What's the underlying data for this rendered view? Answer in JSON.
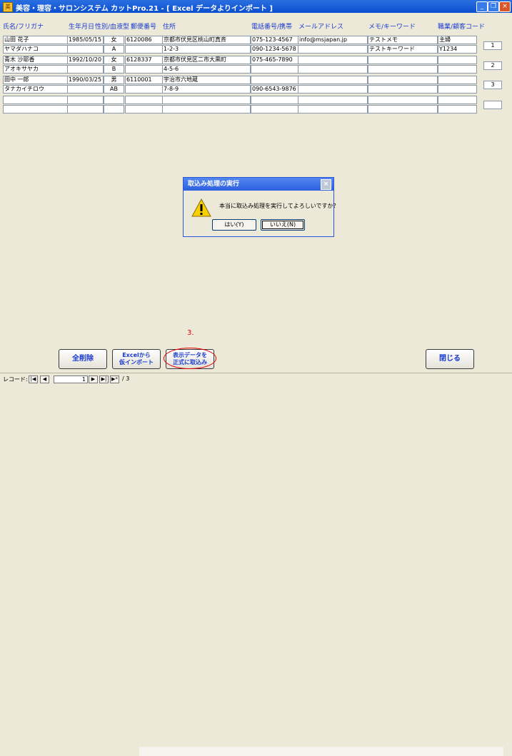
{
  "window": {
    "title": "美容・理容・サロンシステム カットPro.21 - [ Excel データよりインポート ]",
    "icon": "app-icon",
    "buttons": [
      "_",
      "❐",
      "×"
    ]
  },
  "columns": [
    "氏名/フリガナ",
    "生年月日",
    "性別/血液型",
    "郵便番号",
    "住所",
    "電話番号/携帯",
    "メールアドレス",
    "メモ/キーワード",
    "職業/顧客コード"
  ],
  "records": [
    {
      "row1": [
        "山田 花子",
        "1985/05/15",
        "女",
        "6120086",
        "京都市伏見区桃山町真斉",
        "075-123-4567",
        "info@msjapan.jp",
        "テストメモ",
        "主婦"
      ],
      "row2": [
        "ヤマダハナコ",
        "",
        "A",
        "",
        "1-2-3",
        "090-1234-5678",
        "",
        "テストキーワード",
        "Y1234"
      ],
      "page": "1"
    },
    {
      "row1": [
        "青木 沙耶香",
        "1992/10/20",
        "女",
        "6128337",
        "京都市伏見区二市大黒町",
        "075-465-7890",
        "",
        "",
        ""
      ],
      "row2": [
        "アオキサヤカ",
        "",
        "B",
        "",
        "4-5-6",
        "",
        "",
        "",
        ""
      ],
      "page": "2"
    },
    {
      "row1": [
        "田中 一郎",
        "1990/03/25",
        "男",
        "6110001",
        "宇治市六地蔵",
        "",
        "",
        "",
        ""
      ],
      "row2": [
        "タナカイチロウ",
        "",
        "AB",
        "",
        "7-8-9",
        "090-6543-9876",
        "",
        "",
        ""
      ],
      "page": "3"
    },
    {
      "row1": [
        "",
        "",
        "",
        "",
        "",
        "",
        "",
        "",
        ""
      ],
      "row2": [
        "",
        "",
        "",
        "",
        "",
        "",
        "",
        "",
        ""
      ],
      "page": ""
    }
  ],
  "dialog": {
    "title": "取込み処理の実行",
    "message": "本当に取込み処理を実行してよろしいですか？",
    "yes": "はい(Y)",
    "no": "いいえ(N)",
    "icon": "warning-icon"
  },
  "buttons": {
    "delete_all": "全削除",
    "excel_import_1": "Excelから",
    "excel_import_2": "仮インポート",
    "commit_1": "表示データを",
    "commit_2": "正式に取込み",
    "close": "閉じる"
  },
  "annotation": "3.",
  "nav": {
    "label": "レコード:",
    "current": "1",
    "total": "/ 3"
  },
  "colors": {
    "title_bar": "#0A4FCF",
    "header_text": "#1A3AD0",
    "annotation": "#E00000"
  }
}
